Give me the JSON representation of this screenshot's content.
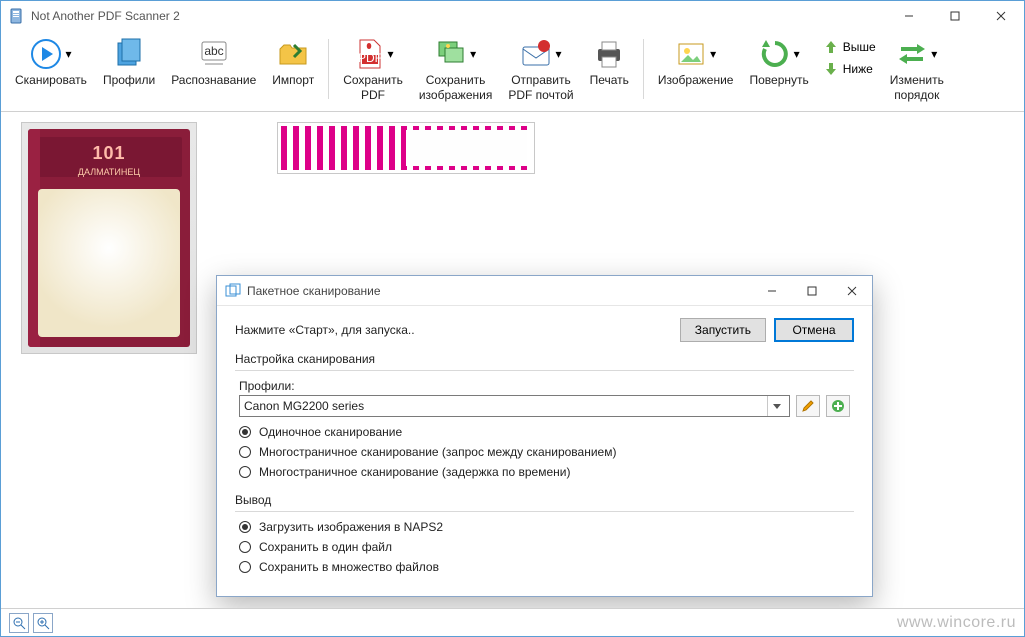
{
  "window": {
    "title": "Not Another PDF Scanner 2"
  },
  "ribbon": {
    "scan": "Сканировать",
    "profiles": "Профили",
    "ocr": "Распознавание",
    "import": "Импорт",
    "save_pdf": "Сохранить\nPDF",
    "save_images": "Сохранить\nизображения",
    "send_pdf": "Отправить\nPDF почтой",
    "print": "Печать",
    "image": "Изображение",
    "rotate": "Повернуть",
    "move_up": "Выше",
    "move_down": "Ниже",
    "reorder": "Изменить\nпорядок"
  },
  "thumbs": {
    "book_title": "101",
    "book_sub": "ДАЛМАТИНЕЦ"
  },
  "dialog": {
    "title": "Пакетное сканирование",
    "instruction": "Нажмите «Старт», для запуска..",
    "start": "Запустить",
    "cancel": "Отмена",
    "scan_settings": "Настройка сканирования",
    "profiles_label": "Профили:",
    "profile_value": "Canon MG2200 series",
    "scan_opts": {
      "single": "Одиночное сканирование",
      "multi_prompt": "Многостраничное сканирование (запрос между сканированием)",
      "multi_delay": "Многостраничное сканирование (задержка по времени)"
    },
    "output_title": "Вывод",
    "output_opts": {
      "load": "Загрузить изображения в NAPS2",
      "one_file": "Сохранить в один файл",
      "many_files": "Сохранить в множество файлов"
    }
  },
  "status": {
    "watermark": "www.wincore.ru"
  }
}
